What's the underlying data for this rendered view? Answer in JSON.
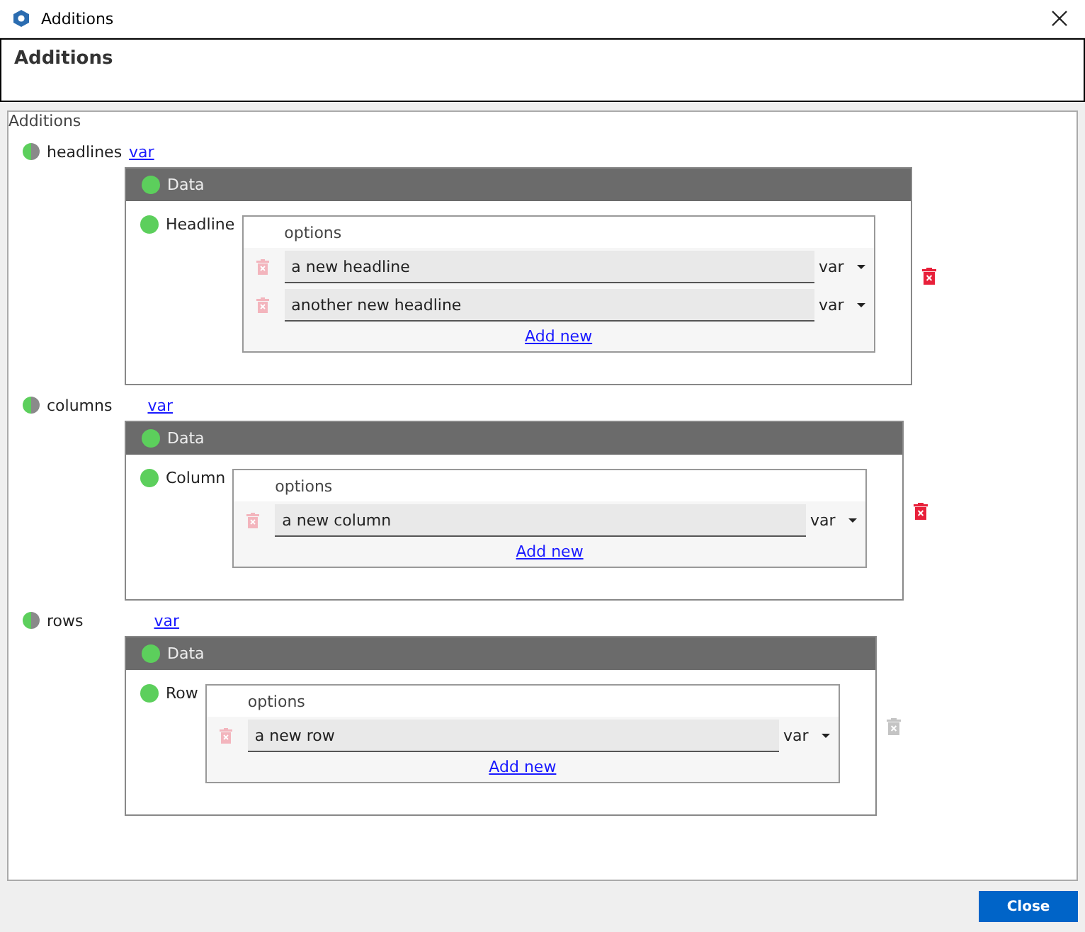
{
  "window": {
    "title": "Additions"
  },
  "header": {
    "title": "Additions"
  },
  "group": {
    "title": "Additions",
    "sections": [
      {
        "name": "headlines",
        "link": "var",
        "panel_title": "Data",
        "item_label": "Headline",
        "options_label": "options",
        "options": [
          {
            "value": "a new headline",
            "type": "var"
          },
          {
            "value": "another new headline",
            "type": "var"
          }
        ],
        "add_label": "Add new",
        "removable": true
      },
      {
        "name": "columns",
        "link": "var",
        "panel_title": "Data",
        "item_label": "Column",
        "options_label": "options",
        "options": [
          {
            "value": "a new column",
            "type": "var"
          }
        ],
        "add_label": "Add new",
        "removable": true
      },
      {
        "name": "rows",
        "link": "var",
        "panel_title": "Data",
        "item_label": "Row",
        "options_label": "options",
        "options": [
          {
            "value": "a new row",
            "type": "var"
          }
        ],
        "add_label": "Add new",
        "removable": false
      }
    ]
  },
  "buttons": {
    "close": "Close"
  }
}
